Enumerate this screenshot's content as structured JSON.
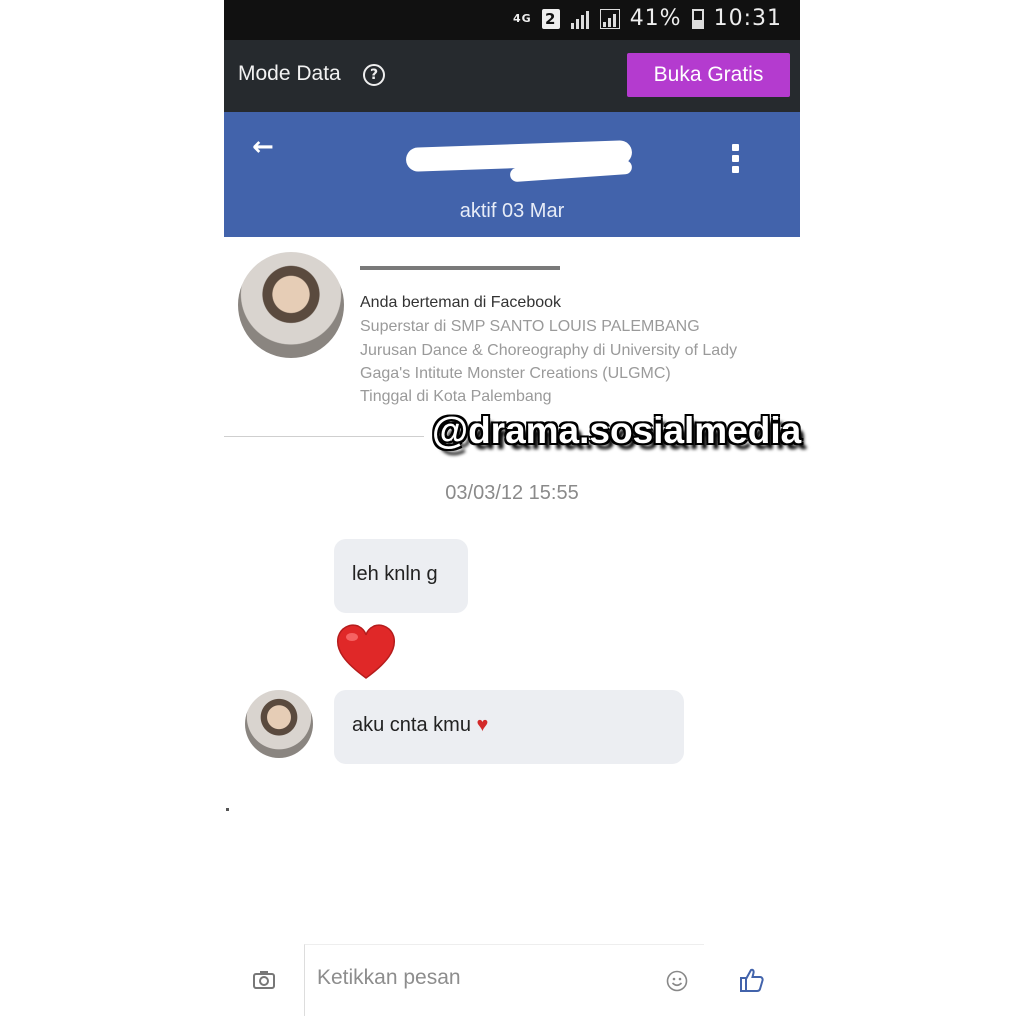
{
  "status_bar": {
    "network": "4G",
    "sim": "2",
    "battery": "41%",
    "battery_level": 0.41,
    "time": "10:31"
  },
  "mode_bar": {
    "label": "Mode Data",
    "help_icon": "help-circle-icon",
    "button_label": "Buka Gratis",
    "button_color": "#b43bcf"
  },
  "header": {
    "back_icon": "arrow-left-icon",
    "more_icon": "vertical-dots-icon",
    "active_status": "aktif 03 Mar",
    "color": "#4263ab"
  },
  "profile": {
    "friend_status": "Anda berteman di Facebook",
    "info": [
      "Superstar di SMP SANTO LOUIS PALEMBANG",
      "Jurusan Dance & Choreography di University of Lady",
      "Gaga's Intitute Monster Creations (ULGMC)",
      "Tinggal di Kota Palembang"
    ]
  },
  "watermark": "@drama.sosialmedia",
  "conversation": {
    "timestamp": "03/03/12 15:55",
    "messages": [
      {
        "text": "leh knln g"
      },
      {
        "text": "aku cnta kmu",
        "suffix": "♥"
      }
    ]
  },
  "composer": {
    "placeholder": "Ketikkan pesan",
    "camera_icon": "camera-icon",
    "emoji_icon": "smiley-icon",
    "like_icon": "thumbs-up-icon"
  }
}
